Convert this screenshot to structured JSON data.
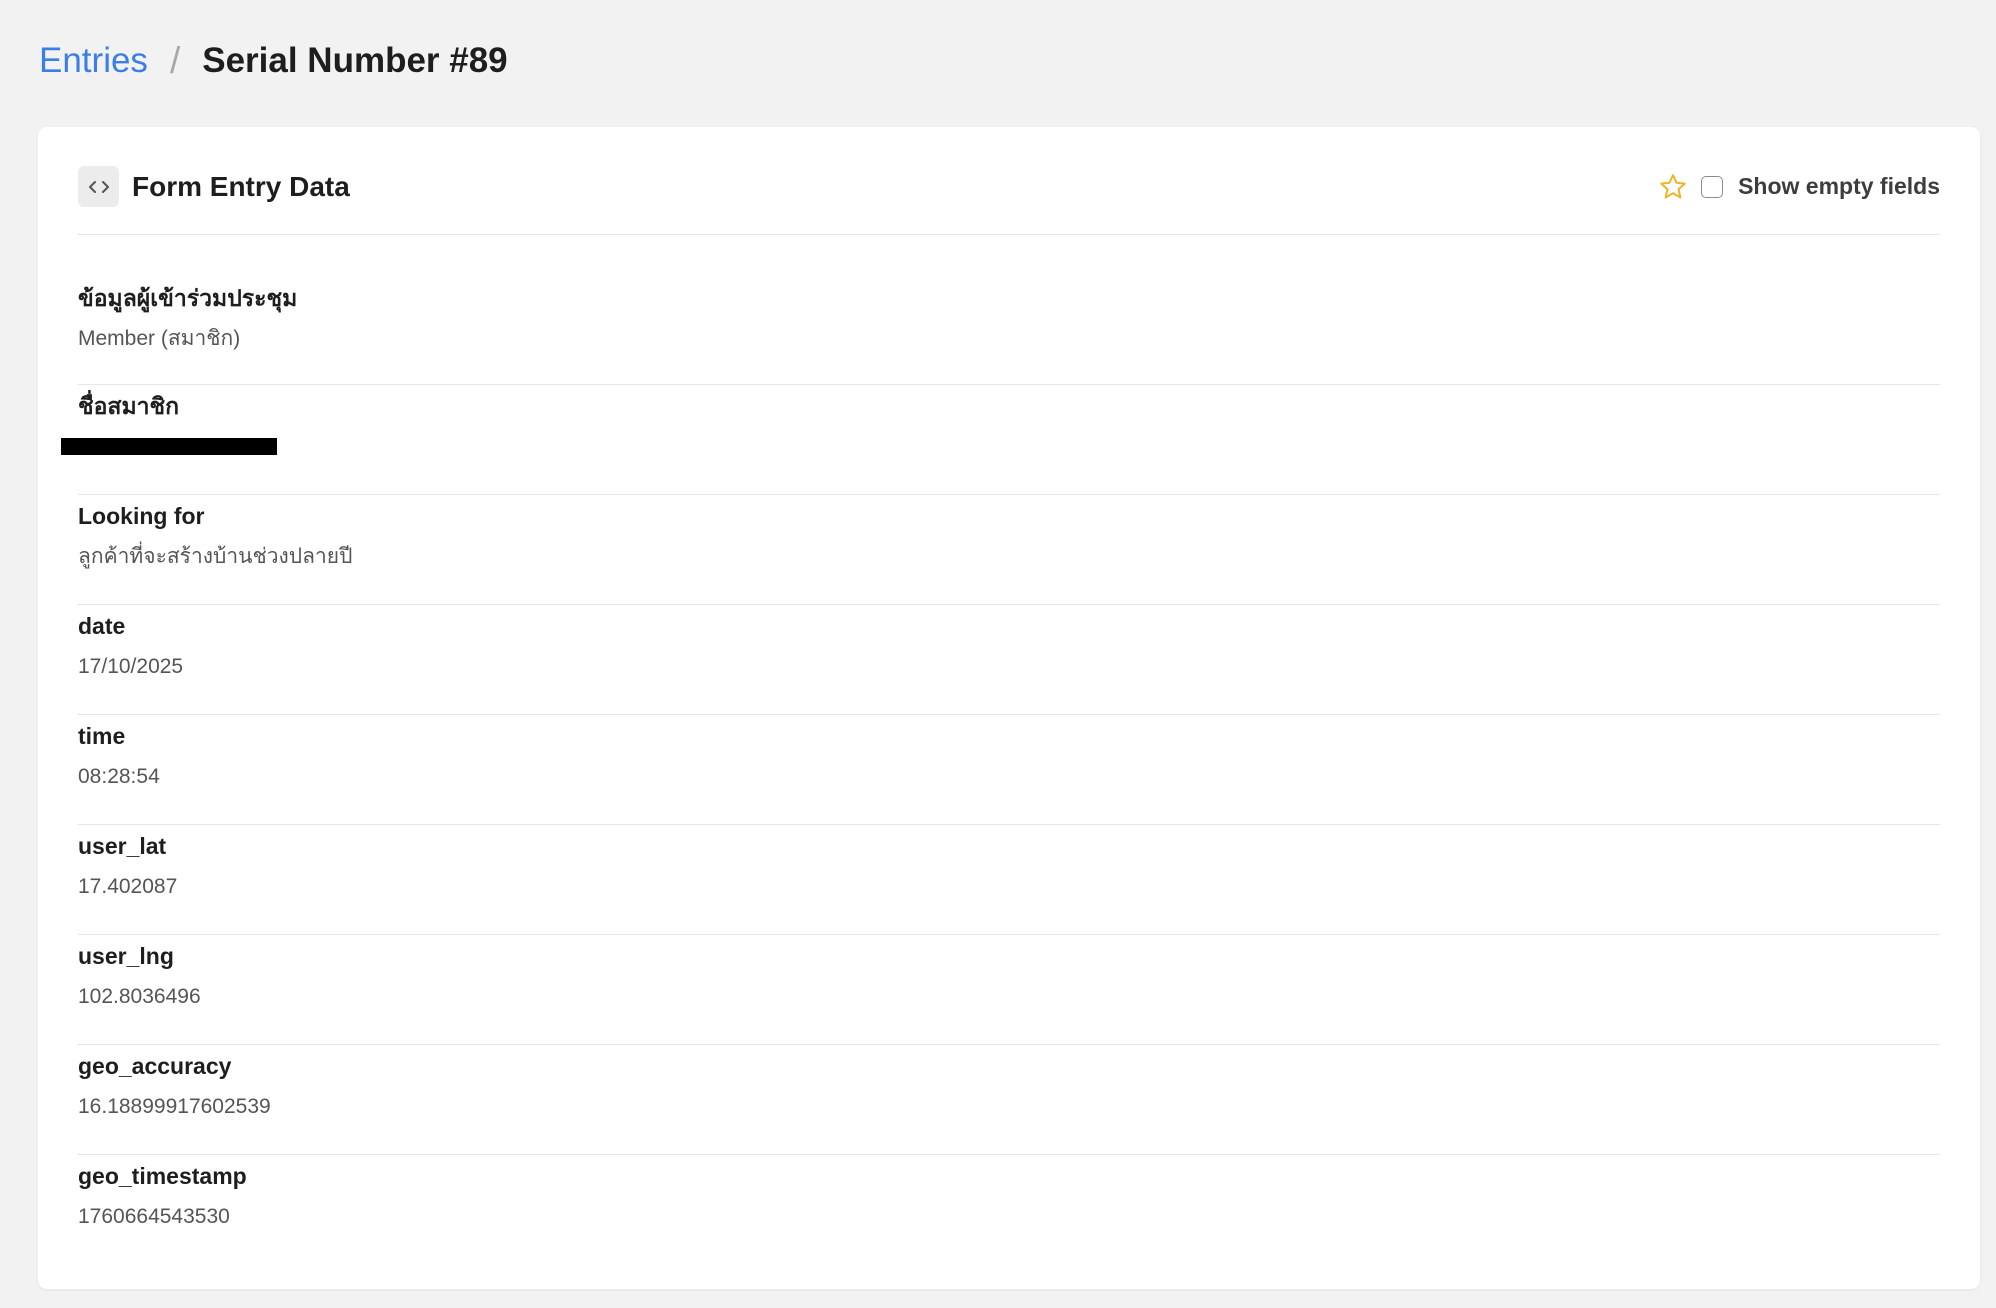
{
  "breadcrumb": {
    "parent": "Entries",
    "separator": "/",
    "current": "Serial Number #89"
  },
  "card": {
    "title": "Form Entry Data",
    "show_empty_label": "Show empty fields",
    "show_empty_checked": false,
    "star_color": "#f0b429"
  },
  "fields": [
    {
      "label": "ข้อมูลผู้เข้าร่วมประชุม",
      "value": "Member (สมาชิก)"
    },
    {
      "label": "ชื่อสมาชิก",
      "value": "",
      "redacted": true
    },
    {
      "label": "Looking for",
      "value": "ลูกค้าที่จะสร้างบ้านช่วงปลายปี"
    },
    {
      "label": "date",
      "value": "17/10/2025"
    },
    {
      "label": "time",
      "value": "08:28:54"
    },
    {
      "label": "user_lat",
      "value": "17.402087"
    },
    {
      "label": "user_lng",
      "value": "102.8036496"
    },
    {
      "label": "geo_accuracy",
      "value": "16.18899917602539"
    },
    {
      "label": "geo_timestamp",
      "value": "1760664543530"
    }
  ],
  "colors": {
    "link": "#3b7ee6",
    "background": "#f2f2f2",
    "card": "#ffffff"
  }
}
